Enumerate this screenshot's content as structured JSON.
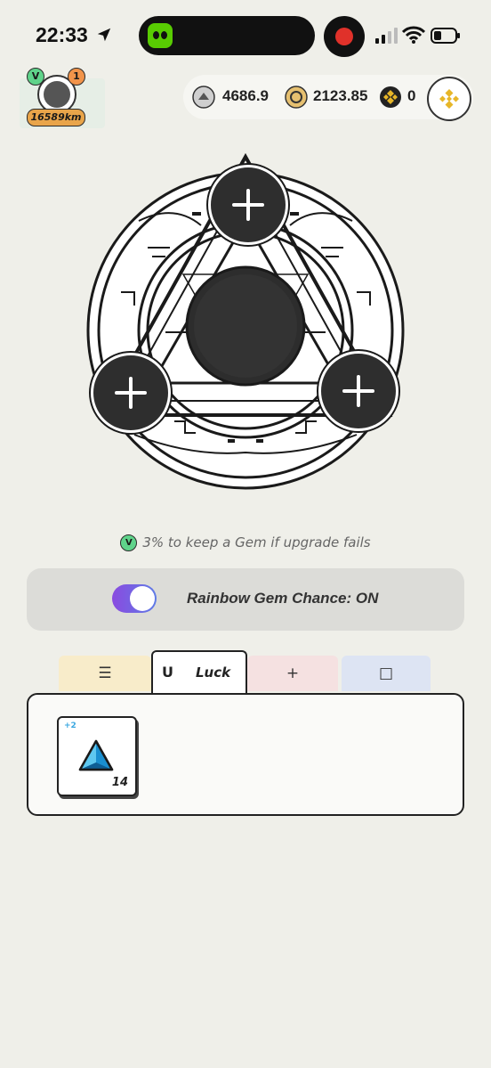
{
  "status_bar": {
    "time": "22:33"
  },
  "profile": {
    "badge_v": "V",
    "badge_count": "1",
    "distance": "16589km"
  },
  "balances": {
    "gst": "4686.9",
    "gmt": "2123.85",
    "bnb": "0"
  },
  "hint": {
    "badge": "V",
    "text": "3% to keep a Gem if upgrade fails"
  },
  "rainbow": {
    "label": "Rainbow Gem Chance: ON",
    "enabled": true
  },
  "tabs": [
    {
      "glyph": "☰"
    },
    {
      "glyph": "U",
      "label": "Luck"
    },
    {
      "glyph": "+"
    },
    {
      "glyph": "□"
    }
  ],
  "inventory": {
    "items": [
      {
        "plus": "+2",
        "count": "14",
        "icon": "luck-gem-icon"
      }
    ]
  },
  "colors": {
    "background": "#efefe9",
    "accent_green": "#5fd38a",
    "accent_orange": "#f2944a",
    "toggle": "#7a5ce3"
  }
}
